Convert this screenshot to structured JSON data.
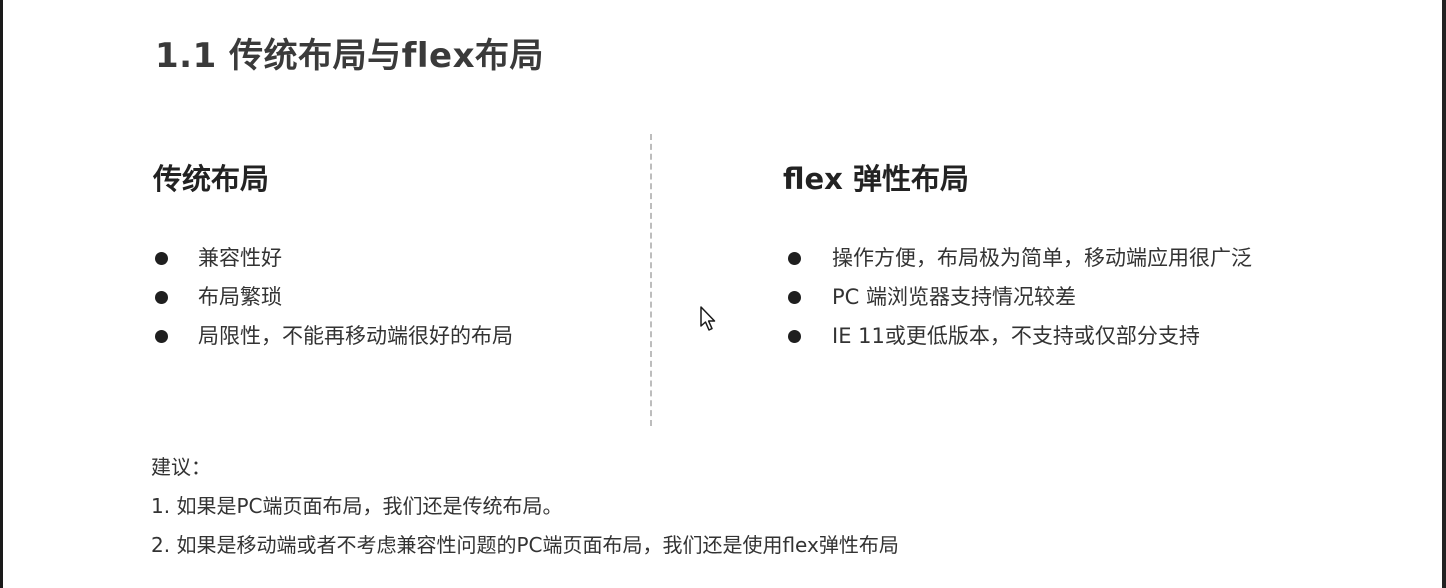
{
  "page": {
    "title": "1.1 传统布局与flex布局"
  },
  "traditional": {
    "heading": "传统布局",
    "items": [
      "兼容性好",
      "布局繁琐",
      "局限性，不能再移动端很好的布局"
    ]
  },
  "flex": {
    "heading": "flex 弹性布局",
    "items": [
      "操作方便，布局极为简单，移动端应用很广泛",
      "PC 端浏览器支持情况较差",
      "IE 11或更低版本，不支持或仅部分支持"
    ]
  },
  "advice": {
    "label": "建议：",
    "lines": [
      "1. 如果是PC端页面布局，我们还是传统布局。",
      "2. 如果是移动端或者不考虑兼容性问题的PC端页面布局，我们还是使用flex弹性布局"
    ]
  },
  "icons": {
    "cursor": "mouse-pointer-icon",
    "bullet": "filled-circle"
  },
  "colors": {
    "text": "#333333",
    "heading": "#222222",
    "divider": "#bdbdbd"
  }
}
